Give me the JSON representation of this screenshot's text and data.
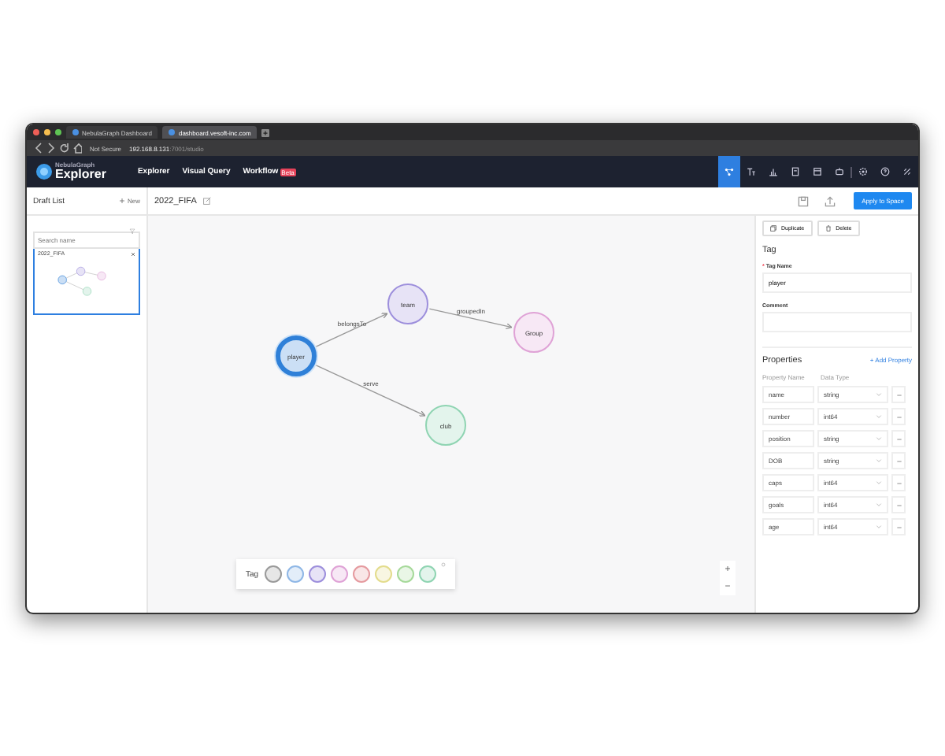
{
  "browser": {
    "tabs": [
      {
        "title": "NebulaGraph Dashboard",
        "selected": false
      },
      {
        "title": "dashboard.vesoft-inc.com",
        "selected": true
      }
    ],
    "address": {
      "security": "Not Secure",
      "host": "192.168.8.131",
      "path": ":7001/studio"
    }
  },
  "app": {
    "brand": "NebulaGraph",
    "product": "Explorer",
    "nav": [
      {
        "label": "Explorer"
      },
      {
        "label": "Visual Query"
      },
      {
        "label": "Workflow",
        "badge": "Beta"
      }
    ],
    "toolbar": [
      {
        "kind": "schema",
        "selected": true
      },
      {
        "kind": "text",
        "selected": false
      },
      {
        "kind": "chart",
        "selected": false
      },
      {
        "kind": "book",
        "selected": false
      },
      {
        "kind": "doc",
        "selected": false
      },
      {
        "kind": "robot",
        "selected": false
      },
      {
        "kind": "settings",
        "selected": false
      },
      {
        "kind": "help",
        "selected": false
      },
      {
        "kind": "link",
        "selected": false
      }
    ]
  },
  "draft_list": {
    "title": "Draft List",
    "new_button": "New",
    "search": {
      "placeholder": "Search name"
    },
    "drafts": [
      {
        "name": "2022_FIFA",
        "selected": true
      }
    ]
  },
  "editor": {
    "title": "2022_FIFA",
    "apply_button": "Apply to Space",
    "nodes": [
      {
        "label": "player",
        "color": "#2f80d8",
        "selected": true
      },
      {
        "label": "team",
        "color": "#9d8fdc",
        "selected": false
      },
      {
        "label": "Group",
        "color": "#dfa2d6",
        "selected": false
      },
      {
        "label": "club",
        "color": "#8fd4b2",
        "selected": false
      }
    ],
    "edges": [
      {
        "label": "belongsTo"
      },
      {
        "label": "groupedIn"
      },
      {
        "label": "serve"
      }
    ],
    "tag_palette": {
      "label": "Tag",
      "colors": [
        {
          "color": "#9a9a9a"
        },
        {
          "color": "#8fb7e6"
        },
        {
          "color": "#9d8fdc"
        },
        {
          "color": "#dfa2d6"
        },
        {
          "color": "#e59a9f"
        },
        {
          "color": "#e3dc8c"
        },
        {
          "color": "#a6d99a"
        },
        {
          "color": "#8fd4b2"
        }
      ]
    },
    "zoom": {
      "in": "+",
      "out": "−"
    }
  },
  "panel": {
    "buttons": [
      "Duplicate",
      "Delete"
    ],
    "section": "Tag",
    "tag_name": {
      "required_mark": "*",
      "label": "Tag Name",
      "value": "player"
    },
    "comment": {
      "label": "Comment"
    },
    "properties": {
      "title": "Properties",
      "add": "+ Add Property",
      "columns": [
        "Property Name",
        "Data Type"
      ],
      "rows": [
        {
          "name": "name",
          "type": "string"
        },
        {
          "name": "number",
          "type": "int64"
        },
        {
          "name": "position",
          "type": "string"
        },
        {
          "name": "DOB",
          "type": "string"
        },
        {
          "name": "caps",
          "type": "int64"
        },
        {
          "name": "goals",
          "type": "int64"
        },
        {
          "name": "age",
          "type": "int64"
        }
      ]
    }
  }
}
